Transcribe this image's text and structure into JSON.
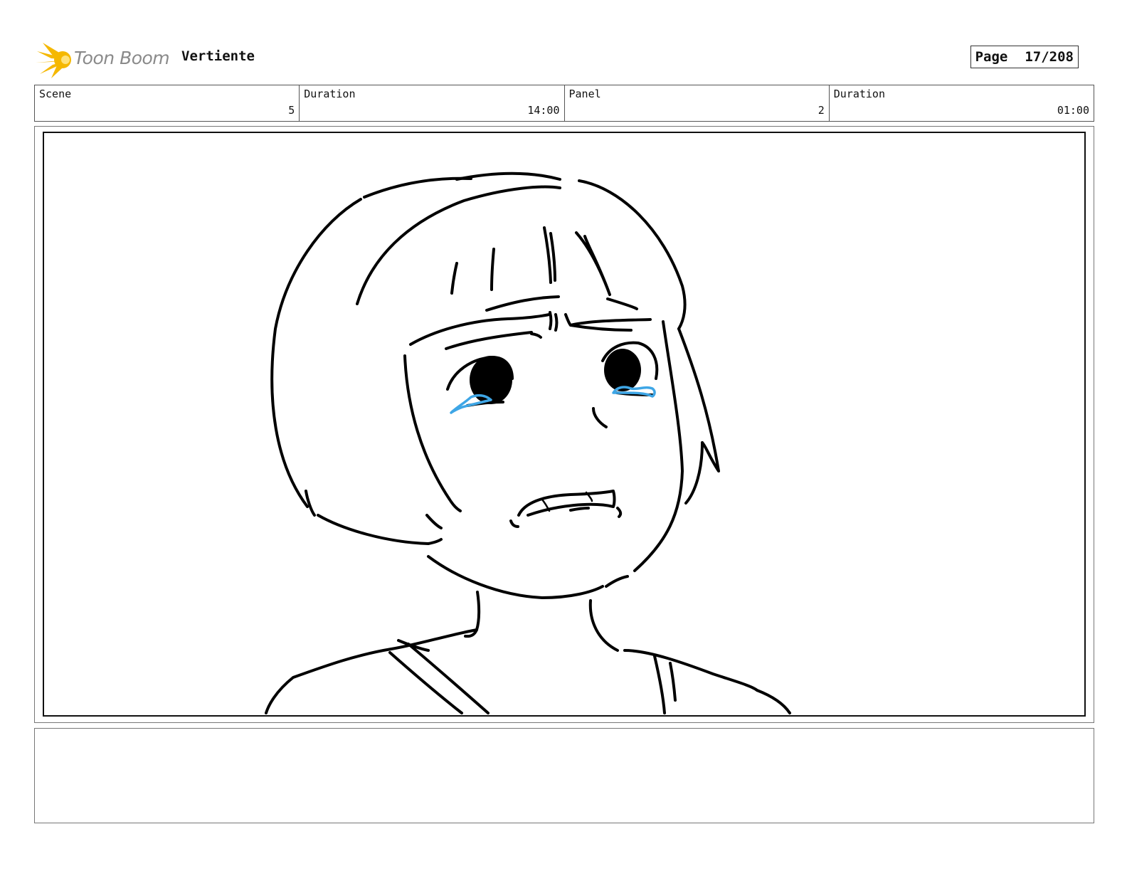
{
  "header": {
    "logo_text": "Toon Boom",
    "project_title": "Vertiente",
    "page_label": "Page",
    "page_value": "17/208"
  },
  "info": [
    {
      "label": "Scene",
      "value": "5"
    },
    {
      "label": "Duration",
      "value": "14:00"
    },
    {
      "label": "Panel",
      "value": "2"
    },
    {
      "label": "Duration",
      "value": "01:00"
    }
  ],
  "colors": {
    "logo_flame": "#f5b800",
    "logo_text": "#8a8a8a",
    "tears": "#3ea6e6",
    "ink": "#000000"
  },
  "notes": {
    "text": ""
  }
}
